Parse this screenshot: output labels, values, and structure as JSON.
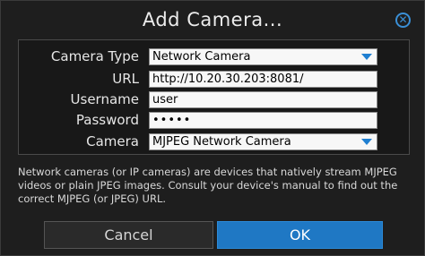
{
  "dialog": {
    "title": "Add Camera...",
    "close_icon": "close-circle-icon"
  },
  "form": {
    "camera_type": {
      "label": "Camera Type",
      "value": "Network Camera"
    },
    "url": {
      "label": "URL",
      "value": "http://10.20.30.203:8081/"
    },
    "username": {
      "label": "Username",
      "value": "user"
    },
    "password": {
      "label": "Password",
      "value": "•••••"
    },
    "camera": {
      "label": "Camera",
      "value": "MJPEG Network Camera"
    }
  },
  "help": {
    "line1": "Network cameras (or IP cameras) are devices that natively stream MJPEG",
    "line2": "videos or plain JPEG images. Consult your device's manual to find out the",
    "line3": "correct MJPEG (or JPEG) URL."
  },
  "buttons": {
    "cancel": "Cancel",
    "ok": "OK"
  },
  "colors": {
    "accent": "#1f78c4",
    "background": "#1e1e1e"
  }
}
